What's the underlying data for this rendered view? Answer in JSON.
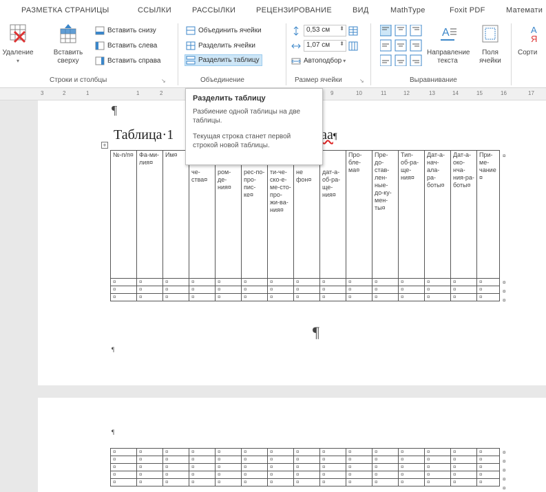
{
  "tabs": [
    "РАЗМЕТКА СТРАНИЦЫ",
    "ССЫЛКИ",
    "РАССЫЛКИ",
    "РЕЦЕНЗИРОВАНИЕ",
    "ВИД",
    "MathType",
    "Foxit PDF",
    "Математи"
  ],
  "ribbon": {
    "delete_label": "Удаление",
    "insert_above_label": "Вставить\nсверху",
    "insert_below": "Вставить снизу",
    "insert_left": "Вставить слева",
    "insert_right": "Вставить справа",
    "rows_cols_group": "Строки и столбцы",
    "merge_cells": "Объединить ячейки",
    "split_cells": "Разделить ячейки",
    "split_table": "Разделить таблицу",
    "merge_group": "Объединение",
    "height_value": "0,53 см",
    "width_value": "1,07 см",
    "autofit": "Автоподбор",
    "cell_size_group": "Размер ячейки",
    "text_direction": "Направление\nтекста",
    "cell_margins": "Поля\nячейки",
    "alignment_group": "Выравнивание",
    "sort": "Сорти"
  },
  "ruler": [
    "3",
    "2",
    "1",
    "1",
    "2",
    "9",
    "10",
    "11",
    "12",
    "13",
    "14",
    "15",
    "16",
    "17"
  ],
  "tooltip": {
    "title": "Разделить таблицу",
    "desc": "Разбиение одной таблицы на две таблицы.",
    "note": "Текущая строка станет первой строкой новой таблицы."
  },
  "document": {
    "pilcrow": "¶",
    "heading_prefix": "Таблица·1",
    "heading_suffix": "ааа",
    "table_headers": [
      "№-п/п¤",
      "Фа-ми-лия¤",
      "Им¤",
      "че-ства¤",
      "ром-де-ния¤",
      "рес-по-про-пис-ке¤",
      "ти-че-ско-е-ме-сто-про-жи-ва-ния¤",
      "не фон¤",
      "дат-а-об-ра-ще-ния¤",
      "Про-бле-ма¤",
      "Пре-до-став-лен-ные-до-ку-мен-ты¤",
      "Тип-об-ра-ще-ния¤",
      "Дат-а-нач-ала-ра-боты¤",
      "Дат-а-око-нча-ния-ра-боты¤",
      "При-ме-чание¤"
    ],
    "cell_mark": "¤"
  },
  "colors": {
    "tooltip_border": "#bfbfbf",
    "active_button": "#cde6f7",
    "shaded_row": "#d3d3d3",
    "spell_underline": "#dd2222"
  }
}
